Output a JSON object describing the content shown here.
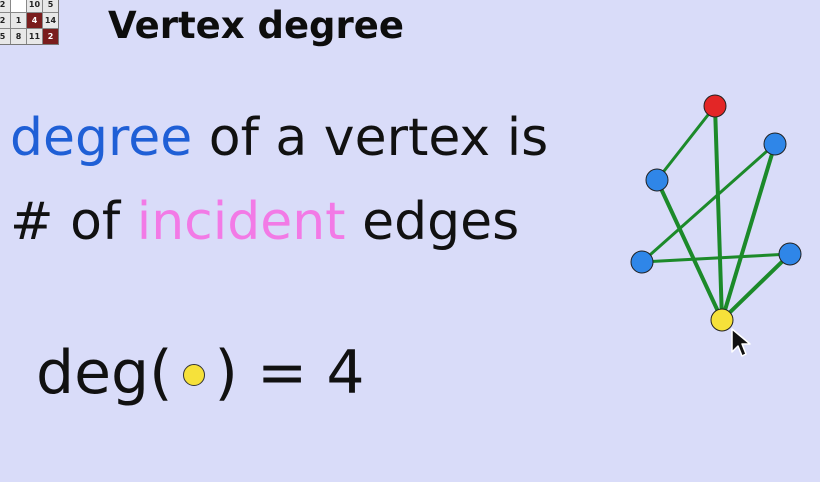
{
  "logo": {
    "cells": [
      {
        "t": "2",
        "style": "light"
      },
      {
        "t": "",
        "style": "blank"
      },
      {
        "t": "10",
        "style": "light"
      },
      {
        "t": "5",
        "style": "light"
      },
      {
        "t": "2",
        "style": "light"
      },
      {
        "t": "1",
        "style": "light"
      },
      {
        "t": "4",
        "style": "dark"
      },
      {
        "t": "14",
        "style": "light"
      },
      {
        "t": "5",
        "style": "light"
      },
      {
        "t": "8",
        "style": "light"
      },
      {
        "t": "11",
        "style": "light"
      },
      {
        "t": "2",
        "style": "dark"
      }
    ]
  },
  "title": "Vertex degree",
  "definition": {
    "line1": {
      "highlight": "degree",
      "rest": " of a vertex is"
    },
    "line2": {
      "before": "# of ",
      "highlight": "incident",
      "after": " edges"
    }
  },
  "formula": {
    "prefix": "deg(",
    "suffix": ") = 4"
  },
  "colors": {
    "background": "#d9dcf9",
    "highlight_degree": "#1f5fd6",
    "highlight_incident": "#f27ae6",
    "edge": "#1c8a2a",
    "vertex_default": "#2f86e8",
    "vertex_red": "#e32626",
    "vertex_selected": "#f6e13a"
  },
  "graph": {
    "vertices": [
      {
        "id": "red",
        "color": "red"
      },
      {
        "id": "upper-right",
        "color": "blue"
      },
      {
        "id": "upper-left",
        "color": "blue"
      },
      {
        "id": "lower-left",
        "color": "blue"
      },
      {
        "id": "lower-right",
        "color": "blue"
      },
      {
        "id": "selected",
        "color": "yellow"
      }
    ],
    "edges": [
      {
        "from": "red",
        "to": "upper-left",
        "width": "thin"
      },
      {
        "from": "red",
        "to": "selected",
        "width": "thick"
      },
      {
        "from": "upper-right",
        "to": "lower-left",
        "width": "thin"
      },
      {
        "from": "upper-right",
        "to": "selected",
        "width": "thick"
      },
      {
        "from": "upper-left",
        "to": "selected",
        "width": "thick"
      },
      {
        "from": "lower-left",
        "to": "lower-right",
        "width": "thin"
      },
      {
        "from": "lower-right",
        "to": "selected",
        "width": "thick"
      }
    ],
    "selected_degree": 4
  },
  "icons": {
    "cursor": "mouse-pointer-icon"
  }
}
